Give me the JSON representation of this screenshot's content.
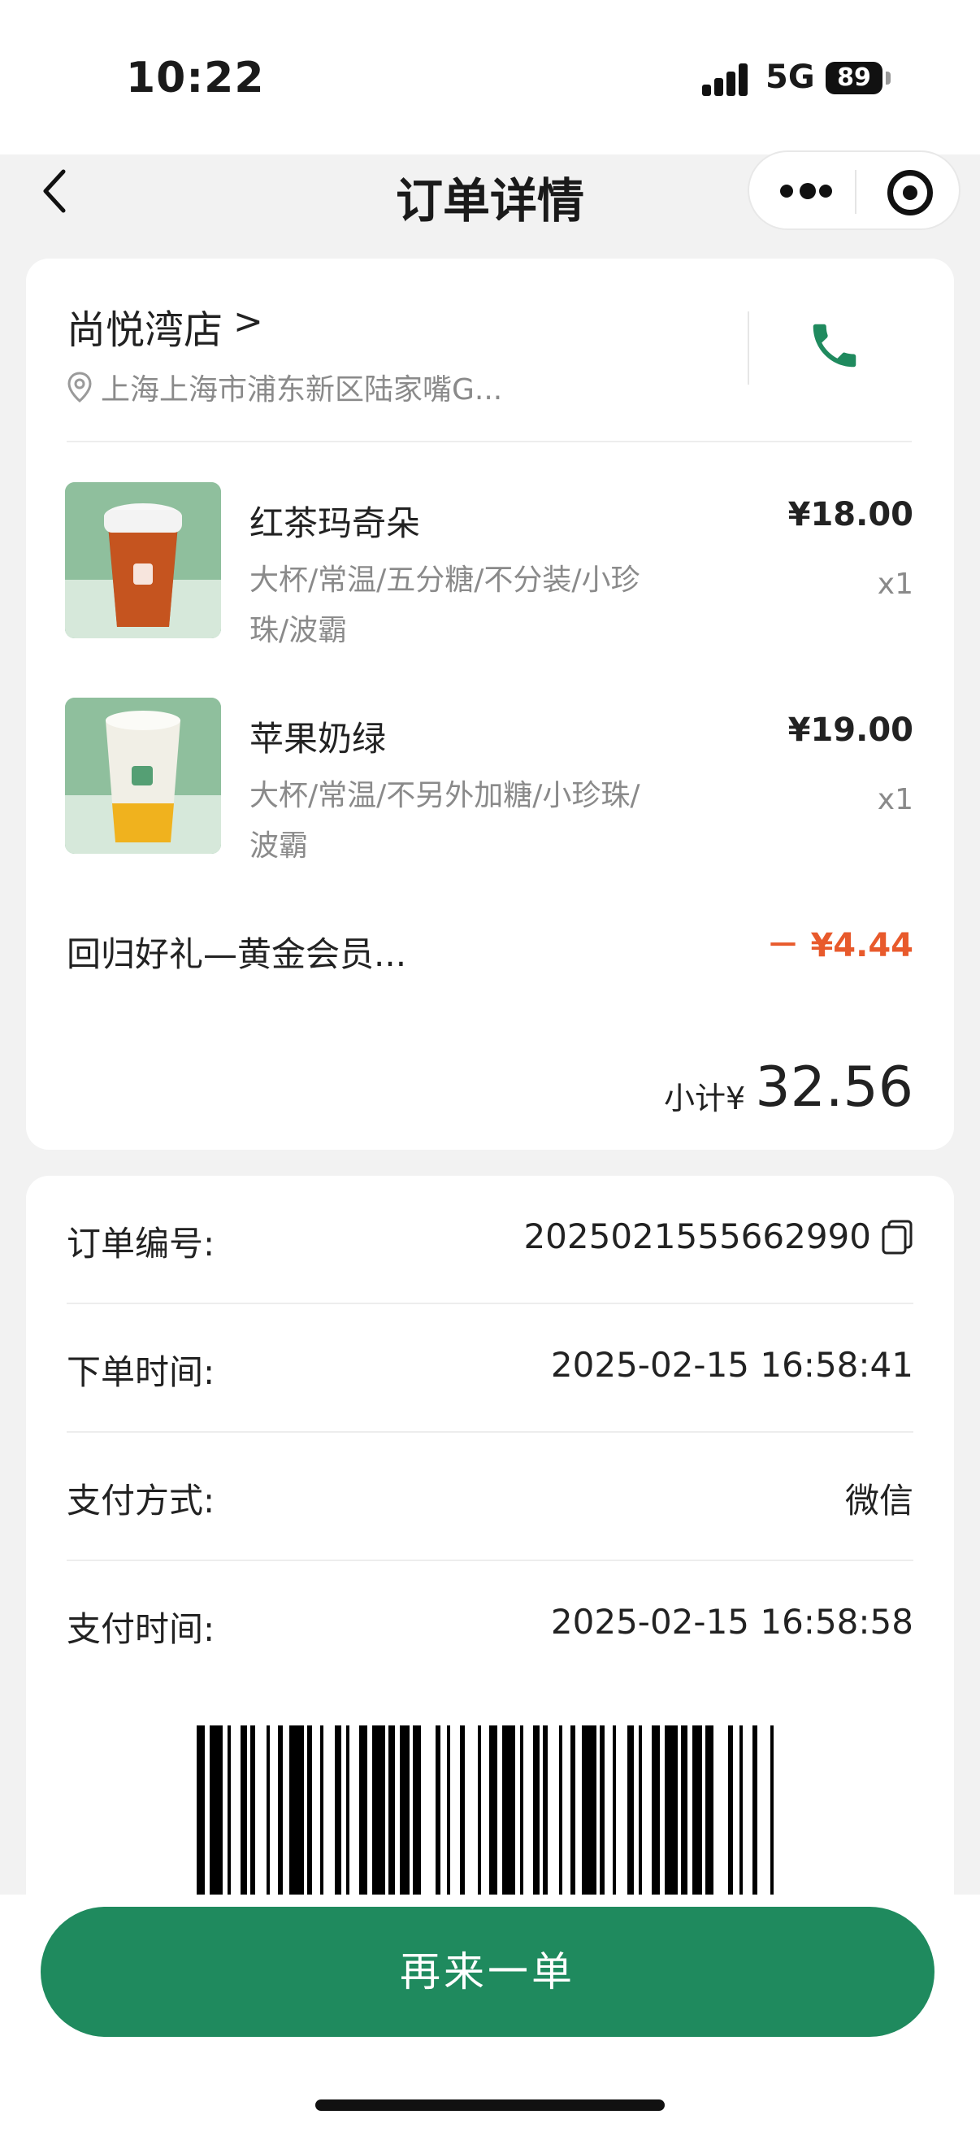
{
  "status_bar": {
    "time": "10:22",
    "network": "5G",
    "battery": "89"
  },
  "nav": {
    "title": "订单详情"
  },
  "store": {
    "name": "尚悦湾店",
    "address": "上海上海市浦东新区陆家嘴G..."
  },
  "items": [
    {
      "name": "红茶玛奇朵",
      "options": "大杯/常温/五分糖/不分装/小珍珠/波霸",
      "price": "¥18.00",
      "qty": "x1"
    },
    {
      "name": "苹果奶绿",
      "options": "大杯/常温/不另外加糖/小珍珠/波霸",
      "price": "¥19.00",
      "qty": "x1"
    }
  ],
  "promotion": {
    "label": "回归好礼—黄金会员...",
    "value": "－ ¥4.44"
  },
  "subtotal": {
    "label": "小计¥",
    "value": "32.56"
  },
  "info": [
    {
      "label": "订单编号:",
      "value": "2025021555662990"
    },
    {
      "label": "下单时间:",
      "value": "2025-02-15 16:58:41"
    },
    {
      "label": "支付方式:",
      "value": "微信"
    },
    {
      "label": "支付时间:",
      "value": "2025-02-15 16:58:58"
    }
  ],
  "actions": {
    "reorder": "再来一单"
  },
  "colors": {
    "brand_green": "#1f8a5e",
    "discount_red": "#e85a2c",
    "muted_text": "#8a8a8a"
  }
}
